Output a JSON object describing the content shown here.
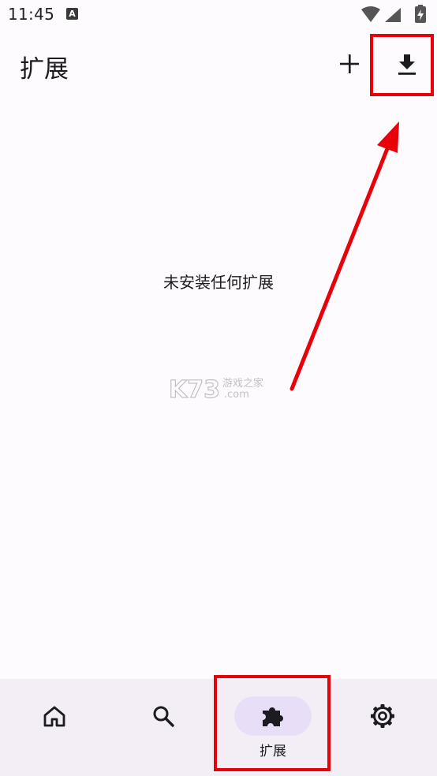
{
  "status_bar": {
    "time": "11:45",
    "notification_icon": "a-notification-icon",
    "icons": [
      "wifi-icon",
      "signal-icon",
      "battery-charging-icon"
    ]
  },
  "app_bar": {
    "title": "扩展",
    "actions": [
      "add-icon",
      "download-icon"
    ]
  },
  "main": {
    "empty_message": "未安装任何扩展"
  },
  "watermark": {
    "logo": "K73",
    "line1": "游戏之家",
    "line2": ".com"
  },
  "bottom_nav": {
    "items": [
      {
        "icon": "home-icon",
        "label": ""
      },
      {
        "icon": "search-icon",
        "label": ""
      },
      {
        "icon": "puzzle-icon",
        "label": "扩展",
        "selected": true
      },
      {
        "icon": "gear-icon",
        "label": ""
      }
    ]
  },
  "colors": {
    "background": "#fefbfe",
    "nav_background": "#f3edf6",
    "nav_indicator": "#e8def8",
    "annotation_red": "#e8000b",
    "text": "#1c1b1f"
  }
}
